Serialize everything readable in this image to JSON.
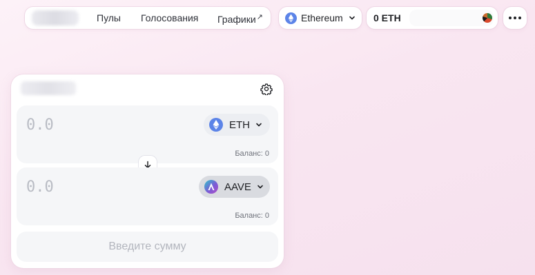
{
  "nav": {
    "links": {
      "pools": "Пулы",
      "votes": "Голосования",
      "charts": "Графики"
    },
    "external_arrow": "↗"
  },
  "network": {
    "label": "Ethereum",
    "icon": "ethereum-icon"
  },
  "account": {
    "balance": "0 ETH"
  },
  "swap": {
    "from": {
      "amount": "0.0",
      "token": "ETH",
      "balance": "Баланс: 0"
    },
    "to": {
      "amount": "0.0",
      "token": "AAVE",
      "balance": "Баланс: 0"
    },
    "submit_label": "Введите сумму"
  },
  "colors": {
    "accent_eth": "#5c84e8",
    "background_pink": "#f9e6f1",
    "disabled_text": "#b2b5bd"
  }
}
